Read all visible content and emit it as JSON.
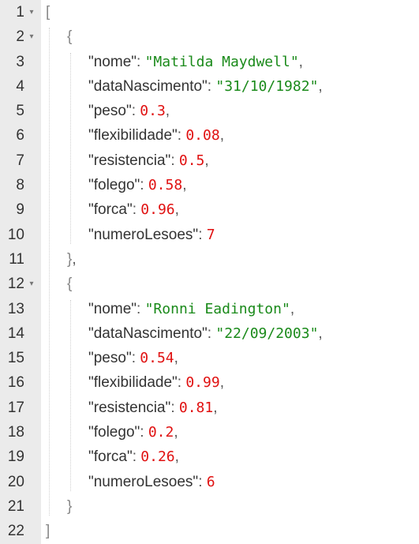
{
  "editor": {
    "fold_symbol": "▾",
    "lines": [
      {
        "n": "1",
        "fold": true,
        "indent": 0,
        "tokens": [
          [
            "bracket",
            "["
          ]
        ]
      },
      {
        "n": "2",
        "fold": true,
        "indent": 1,
        "tokens": [
          [
            "bracket",
            "{"
          ]
        ]
      },
      {
        "n": "3",
        "fold": false,
        "indent": 2,
        "tokens": [
          [
            "key",
            "\"nome\""
          ],
          [
            "punct",
            ": "
          ],
          [
            "str",
            "\"Matilda Maydwell\""
          ],
          [
            "punct",
            ","
          ]
        ]
      },
      {
        "n": "4",
        "fold": false,
        "indent": 2,
        "tokens": [
          [
            "key",
            "\"dataNascimento\""
          ],
          [
            "punct",
            ": "
          ],
          [
            "str",
            "\"31/10/1982\""
          ],
          [
            "punct",
            ","
          ]
        ]
      },
      {
        "n": "5",
        "fold": false,
        "indent": 2,
        "tokens": [
          [
            "key",
            "\"peso\""
          ],
          [
            "punct",
            ": "
          ],
          [
            "num",
            "0.3"
          ],
          [
            "punct",
            ","
          ]
        ]
      },
      {
        "n": "6",
        "fold": false,
        "indent": 2,
        "tokens": [
          [
            "key",
            "\"flexibilidade\""
          ],
          [
            "punct",
            ": "
          ],
          [
            "num",
            "0.08"
          ],
          [
            "punct",
            ","
          ]
        ]
      },
      {
        "n": "7",
        "fold": false,
        "indent": 2,
        "tokens": [
          [
            "key",
            "\"resistencia\""
          ],
          [
            "punct",
            ": "
          ],
          [
            "num",
            "0.5"
          ],
          [
            "punct",
            ","
          ]
        ]
      },
      {
        "n": "8",
        "fold": false,
        "indent": 2,
        "tokens": [
          [
            "key",
            "\"folego\""
          ],
          [
            "punct",
            ": "
          ],
          [
            "num",
            "0.58"
          ],
          [
            "punct",
            ","
          ]
        ]
      },
      {
        "n": "9",
        "fold": false,
        "indent": 2,
        "tokens": [
          [
            "key",
            "\"forca\""
          ],
          [
            "punct",
            ": "
          ],
          [
            "num",
            "0.96"
          ],
          [
            "punct",
            ","
          ]
        ]
      },
      {
        "n": "10",
        "fold": false,
        "indent": 2,
        "tokens": [
          [
            "key",
            "\"numeroLesoes\""
          ],
          [
            "punct",
            ": "
          ],
          [
            "num",
            "7"
          ]
        ]
      },
      {
        "n": "11",
        "fold": false,
        "indent": 1,
        "tokens": [
          [
            "bracket",
            "}"
          ],
          [
            "punct",
            ","
          ]
        ]
      },
      {
        "n": "12",
        "fold": true,
        "indent": 1,
        "tokens": [
          [
            "bracket",
            "{"
          ]
        ]
      },
      {
        "n": "13",
        "fold": false,
        "indent": 2,
        "tokens": [
          [
            "key",
            "\"nome\""
          ],
          [
            "punct",
            ": "
          ],
          [
            "str",
            "\"Ronni Eadington\""
          ],
          [
            "punct",
            ","
          ]
        ]
      },
      {
        "n": "14",
        "fold": false,
        "indent": 2,
        "tokens": [
          [
            "key",
            "\"dataNascimento\""
          ],
          [
            "punct",
            ": "
          ],
          [
            "str",
            "\"22/09/2003\""
          ],
          [
            "punct",
            ","
          ]
        ]
      },
      {
        "n": "15",
        "fold": false,
        "indent": 2,
        "tokens": [
          [
            "key",
            "\"peso\""
          ],
          [
            "punct",
            ": "
          ],
          [
            "num",
            "0.54"
          ],
          [
            "punct",
            ","
          ]
        ]
      },
      {
        "n": "16",
        "fold": false,
        "indent": 2,
        "tokens": [
          [
            "key",
            "\"flexibilidade\""
          ],
          [
            "punct",
            ": "
          ],
          [
            "num",
            "0.99"
          ],
          [
            "punct",
            ","
          ]
        ]
      },
      {
        "n": "17",
        "fold": false,
        "indent": 2,
        "tokens": [
          [
            "key",
            "\"resistencia\""
          ],
          [
            "punct",
            ": "
          ],
          [
            "num",
            "0.81"
          ],
          [
            "punct",
            ","
          ]
        ]
      },
      {
        "n": "18",
        "fold": false,
        "indent": 2,
        "tokens": [
          [
            "key",
            "\"folego\""
          ],
          [
            "punct",
            ": "
          ],
          [
            "num",
            "0.2"
          ],
          [
            "punct",
            ","
          ]
        ]
      },
      {
        "n": "19",
        "fold": false,
        "indent": 2,
        "tokens": [
          [
            "key",
            "\"forca\""
          ],
          [
            "punct",
            ": "
          ],
          [
            "num",
            "0.26"
          ],
          [
            "punct",
            ","
          ]
        ]
      },
      {
        "n": "20",
        "fold": false,
        "indent": 2,
        "tokens": [
          [
            "key",
            "\"numeroLesoes\""
          ],
          [
            "punct",
            ": "
          ],
          [
            "num",
            "6"
          ]
        ]
      },
      {
        "n": "21",
        "fold": false,
        "indent": 1,
        "tokens": [
          [
            "bracket",
            "}"
          ]
        ]
      },
      {
        "n": "22",
        "fold": false,
        "indent": 0,
        "tokens": [
          [
            "bracket",
            "]"
          ]
        ]
      }
    ]
  },
  "colors": {
    "string": "#1a8a1a",
    "number": "#e01010",
    "gutter_bg": "#ebebeb"
  }
}
